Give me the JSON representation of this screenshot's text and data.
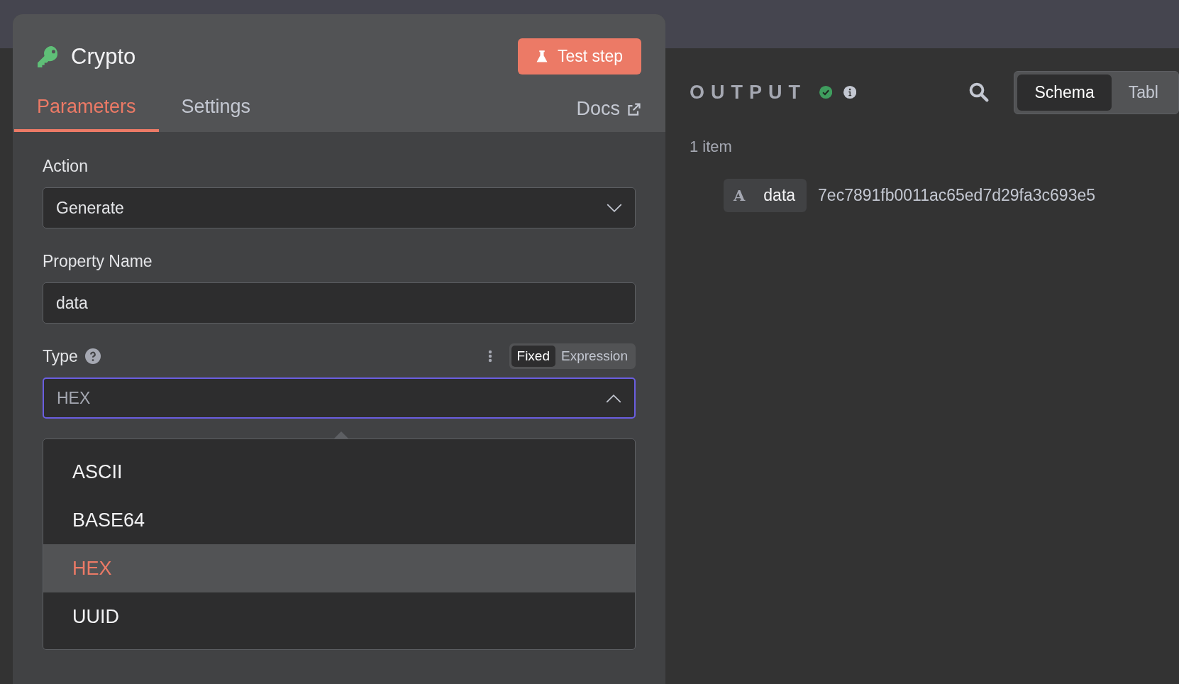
{
  "node": {
    "title": "Crypto",
    "test_button": "Test step"
  },
  "tabs": [
    {
      "label": "Parameters",
      "selected": true
    },
    {
      "label": "Settings",
      "selected": false
    }
  ],
  "docs_link": "Docs",
  "fields": [
    {
      "kind": "select",
      "label": "Action",
      "value": "Generate",
      "open": false
    },
    {
      "kind": "text",
      "label": "Property Name",
      "value": "data"
    },
    {
      "kind": "select",
      "label": "Type",
      "value": "HEX",
      "open": true,
      "help": true,
      "modes": [
        {
          "label": "Fixed",
          "selected": true
        },
        {
          "label": "Expression",
          "selected": false
        }
      ]
    }
  ],
  "dropdown": [
    {
      "label": "ASCII",
      "selected": false
    },
    {
      "label": "BASE64",
      "selected": false
    },
    {
      "label": "HEX",
      "selected": true
    },
    {
      "label": "UUID",
      "selected": false
    }
  ],
  "output": {
    "title": "OUTPUT",
    "success": true,
    "views": [
      {
        "label": "Schema",
        "selected": true
      },
      {
        "label": "Tabl",
        "selected": false
      }
    ],
    "count": "1 item",
    "rows": [
      {
        "type_glyph": "A",
        "key": "data",
        "value": "7ec7891fb0011ac65ed7d29fa3c693e5"
      }
    ]
  }
}
